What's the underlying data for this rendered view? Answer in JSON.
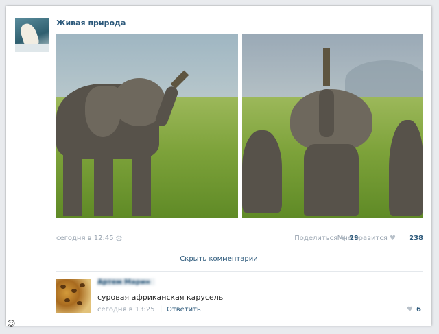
{
  "post": {
    "group_name": "Живая природа",
    "date": "сегодня в 12:45",
    "share_label": "Поделиться",
    "share_count": "29",
    "like_label": "Мне нравится",
    "like_count": "238"
  },
  "comments": {
    "hide_label": "Скрыть комментарии",
    "items": [
      {
        "author": "Артем Марин",
        "text": "суровая африканская карусель",
        "date": "сегодня в 13:25",
        "reply_label": "Ответить",
        "like_count": "6"
      }
    ]
  },
  "colors": {
    "link": "#2b587a",
    "meta": "#9aa5b1",
    "background": "#e9ebee"
  },
  "icons": [
    "gear-icon",
    "megaphone-icon",
    "heart-icon",
    "watermark-icon"
  ]
}
